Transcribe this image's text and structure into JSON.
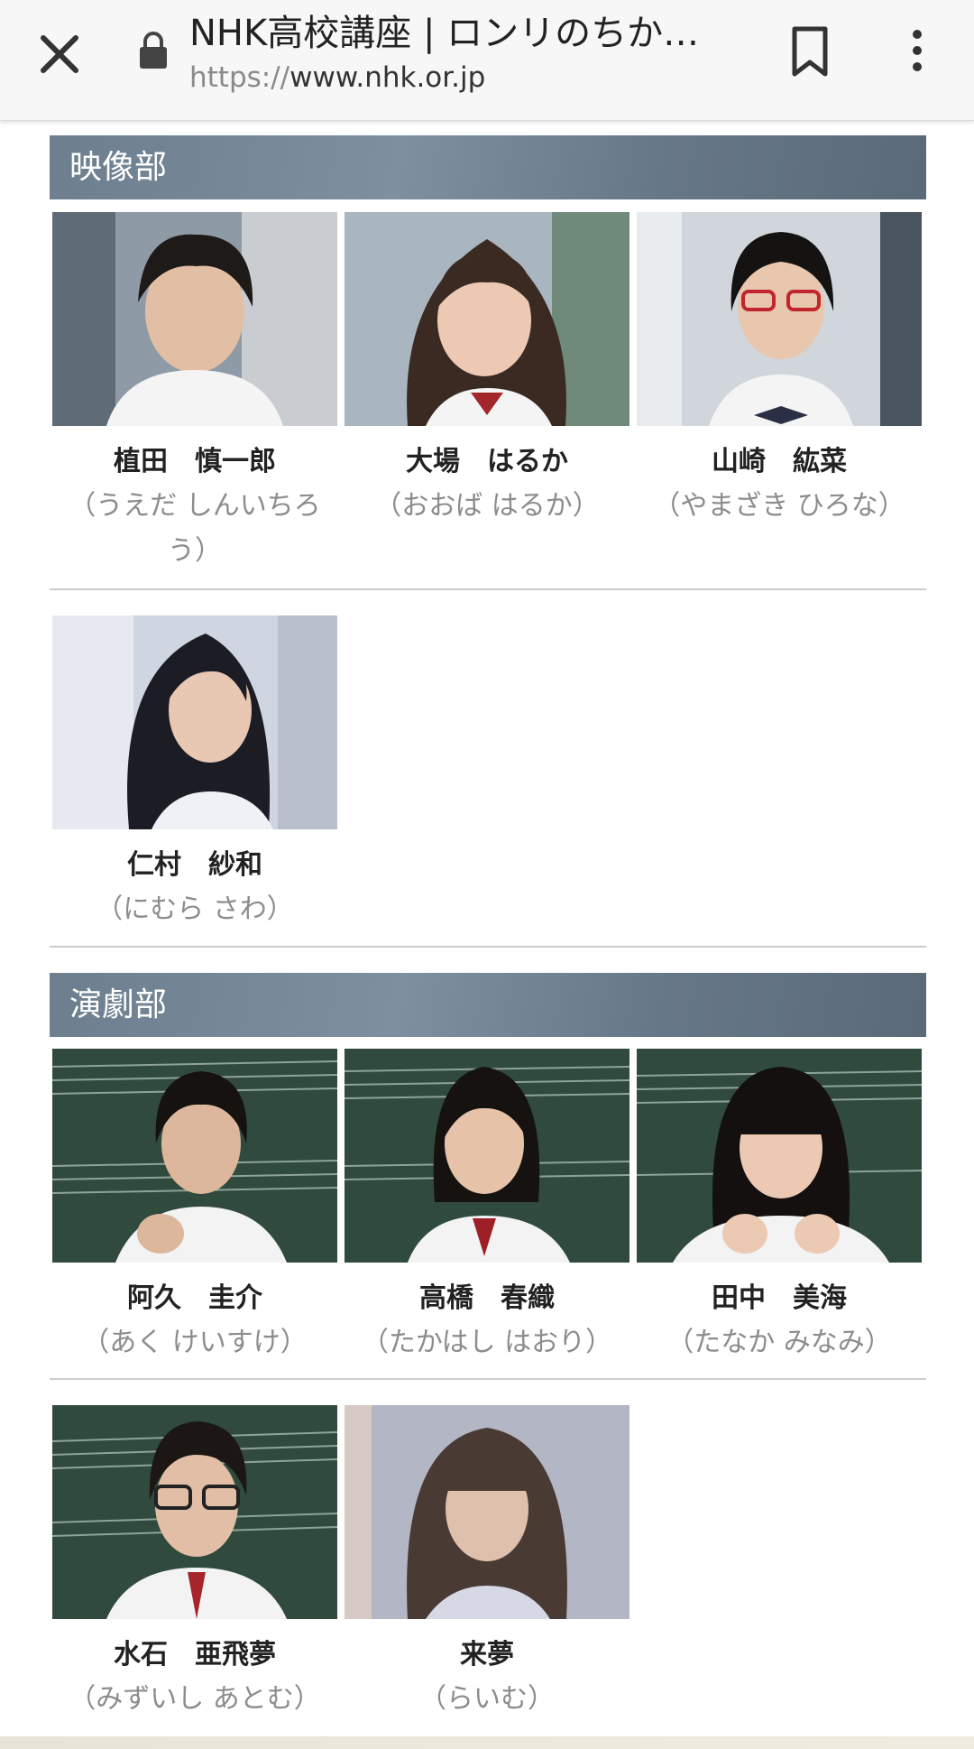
{
  "browser": {
    "title": "NHK高校講座 | ロンリのちか…",
    "url_scheme": "https://",
    "url_host": "www.nhk.or.jp"
  },
  "sections": [
    {
      "title": "映像部",
      "members": [
        {
          "name": "植田　慎一郎",
          "reading": "（うえだ しんいちろう）"
        },
        {
          "name": "大場　はるか",
          "reading": "（おおば はるか）"
        },
        {
          "name": "山崎　紘菜",
          "reading": "（やまざき ひろな）"
        },
        {
          "name": "仁村　紗和",
          "reading": "（にむら さわ）"
        }
      ]
    },
    {
      "title": "演劇部",
      "members": [
        {
          "name": "阿久　圭介",
          "reading": "（あく けいすけ）"
        },
        {
          "name": "高橋　春織",
          "reading": "（たかはし はおり）"
        },
        {
          "name": "田中　美海",
          "reading": "（たなか みなみ）"
        },
        {
          "name": "水石　亜飛夢",
          "reading": "（みずいし あとむ）"
        },
        {
          "name": "来夢",
          "reading": "（らいむ）"
        }
      ]
    }
  ]
}
